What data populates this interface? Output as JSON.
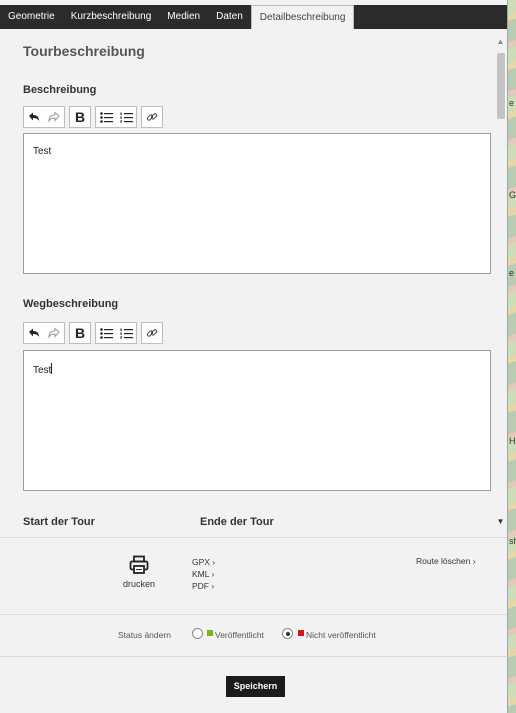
{
  "tabs": [
    {
      "label": "Geometrie"
    },
    {
      "label": "Kurzbeschreibung"
    },
    {
      "label": "Medien"
    },
    {
      "label": "Daten"
    },
    {
      "label": "Detailbeschreibung"
    }
  ],
  "active_tab": "Detailbeschreibung",
  "heading": "Tourbeschreibung",
  "beschreibung": {
    "label": "Beschreibung",
    "value": "Test"
  },
  "wegbeschreibung": {
    "label": "Wegbeschreibung",
    "value": "Test"
  },
  "tour": {
    "start_label": "Start der Tour",
    "end_label": "Ende der Tour"
  },
  "actions": {
    "print_label": "drucken",
    "gpx": "GPX ›",
    "kml": "KML ›",
    "pdf": "PDF ›",
    "delete_route": "Route löschen ›"
  },
  "status": {
    "label": "Status ändern",
    "published": "Veröffentlicht",
    "unpublished": "Nicht veröffentlicht",
    "selected": "Nicht veröffentlicht",
    "published_color": "#7ab51d",
    "unpublished_color": "#cc1a1a"
  },
  "save_label": "Speichern",
  "map_edge_chars": [
    "e",
    "G",
    "e",
    "H",
    "sh"
  ]
}
